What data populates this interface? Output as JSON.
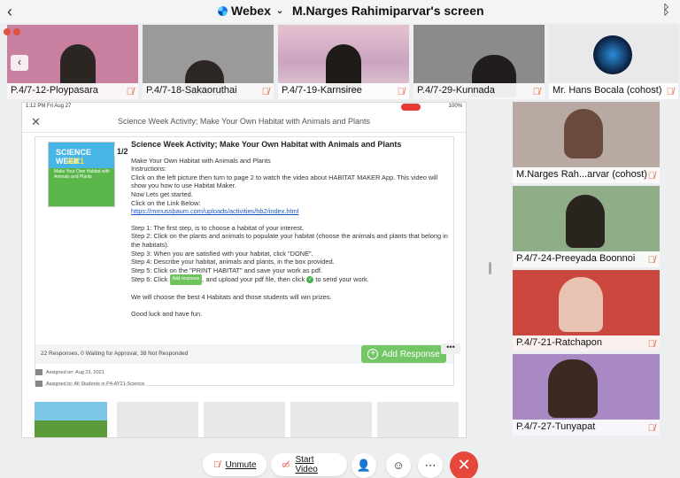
{
  "topbar": {
    "app_name": "Webex",
    "screen_title": "M.Narges Rahimiparvar's screen"
  },
  "top_participants": [
    {
      "name": "P.4/7-12-Ploypasara",
      "bg": "#c87fa0"
    },
    {
      "name": "P.4/7-18-Sakaoruthai",
      "bg": "#9a9a9a"
    },
    {
      "name": "P.4/7-19-Karnsiree",
      "bg": "#d9a7b6"
    },
    {
      "name": "P.4/7-29-Kunnada",
      "bg": "#8b8b8b"
    },
    {
      "name": "Mr. Hans Bocala (cohost)",
      "bg": "#e9e9ea"
    }
  ],
  "share": {
    "status_time": "1:12 PM  Fri Aug 27",
    "status_battery": "100%",
    "header_title": "Science Week Activity; Make Your Own Habitat with Animals and Plants",
    "thumb": {
      "line1": "SCIENCE WEEK",
      "line2": "2021",
      "line3": "Make Your Own Habitat with Animals and Plants",
      "pager": "1/2"
    },
    "post": {
      "title": "Science Week Activity; Make Your Own Habitat with Animals and Plants",
      "l1": "Make Your Own Habitat with Animals and Plants",
      "l2": "Instructions:",
      "l3": "Click on the left picture then turn to page 2 to watch the video about HABITAT MAKER App. This video will show you how to use Habitat Maker.",
      "l4": "Now Lets get started.",
      "l5": "Click on the Link Below:",
      "link": "https://mrnussbaum.com/uploads/activities/hb2/index.html",
      "s1": "Step 1: The first step, is to choose a habitat of your interest.",
      "s2": "Step 2: Click on the plants and animals to populate your habitat (choose the animals and plants that belong in the habitats).",
      "s3": "Step 3: When you are satisfied with your habitat, click \"DONE\".",
      "s4": "Step 4: Describe your habitat, animals and plants, in the box provided.",
      "s5": "Step 5: Click on the \"PRINT HABITAT\" and save your work as pdf.",
      "s6a": "Step 6: Click",
      "s6btn": "Add response",
      "s6b": ", and upload your pdf file, then click",
      "s6c": "to send your work.",
      "p1": "We will choose the best 4 Habitats and those students will win prizes.",
      "p2": "Good luck and have fun."
    },
    "responses": "22 Responses, 0 Waiting for Approval, 38 Not Responded",
    "add_response": "Add Response",
    "assigned_on": "Assigned on: Aug 23, 2021",
    "assigned_to": "Assigned to: All Students in P4-AY21-Science"
  },
  "right_participants": [
    {
      "name": "M.Narges Rah...arvar (cohost)",
      "bg": "#b8aaa2"
    },
    {
      "name": "P.4/7-24-Preeyada Boonnoi",
      "bg": "#8fae88"
    },
    {
      "name": "P.4/7-21-Ratchapon",
      "bg": "#c9473e"
    },
    {
      "name": "P.4/7-27-Tunyapat",
      "bg": "#a889c4"
    }
  ],
  "controls": {
    "unmute": "Unmute",
    "start_video": "Start Video"
  },
  "icons": {
    "back": "chevron-left-icon",
    "bluetooth": "bluetooth-icon",
    "mic_muted": "mic-muted-icon",
    "video_off": "video-off-icon",
    "participants": "participants-icon",
    "reactions": "reactions-icon",
    "more": "more-icon",
    "end": "end-call-icon"
  },
  "colors": {
    "accent_red": "#e5483b",
    "add_green": "#74c566",
    "link_blue": "#1a57c6"
  }
}
